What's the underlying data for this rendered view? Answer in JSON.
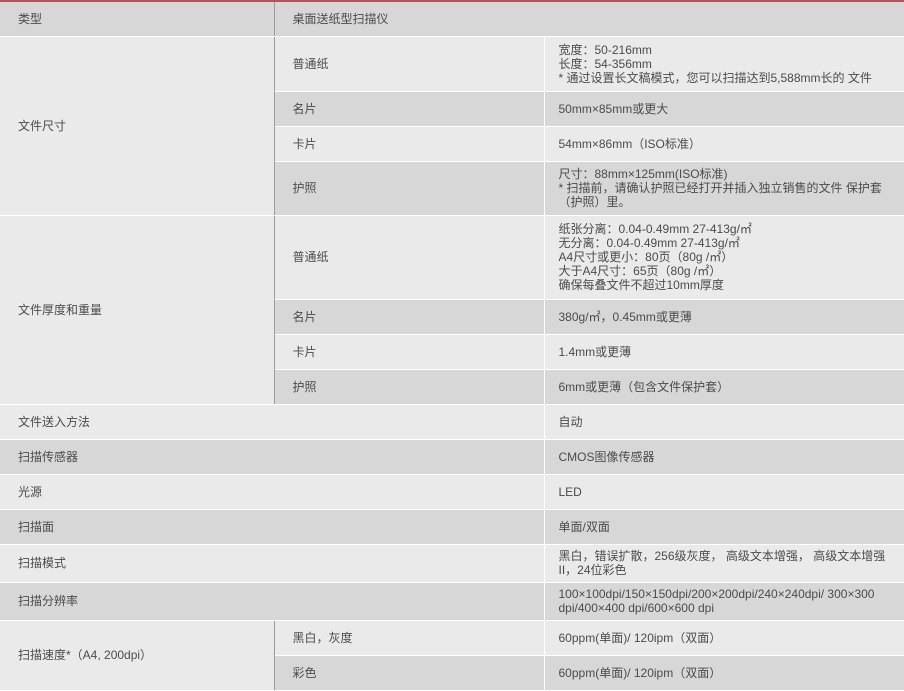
{
  "header": {
    "label": "类型",
    "value": "桌面送纸型扫描仪"
  },
  "doc_size": {
    "label": "文件尺寸",
    "rows": [
      {
        "sub": "普通纸",
        "lines": [
          "宽度：50-216mm",
          "长度：54-356mm",
          "* 通过设置长文稿模式，您可以扫描达到5,588mm长的 文件"
        ]
      },
      {
        "sub": "名片",
        "lines": [
          "50mm×85mm或更大"
        ]
      },
      {
        "sub": "卡片",
        "lines": [
          "54mm×86mm（ISO标准）"
        ]
      },
      {
        "sub": "护照",
        "lines": [
          "尺寸：88mm×125mm(ISO标准)",
          "* 扫描前，请确认护照已经打开并插入独立销售的文件 保护套",
          "（护照）里。"
        ]
      }
    ]
  },
  "doc_thickness": {
    "label": "文件厚度和重量",
    "rows": [
      {
        "sub": "普通纸",
        "lines": [
          "纸张分离：0.04-0.49mm 27-413g/㎡",
          "无分离：0.04-0.49mm 27-413g/㎡",
          "A4尺寸或更小：80页（80g /㎡）",
          "大于A4尺寸：65页（80g /㎡）",
          "确保每叠文件不超过10mm厚度"
        ]
      },
      {
        "sub": "名片",
        "lines": [
          "380g/㎡，0.45mm或更薄"
        ]
      },
      {
        "sub": "卡片",
        "lines": [
          "1.4mm或更薄"
        ]
      },
      {
        "sub": "护照",
        "lines": [
          "6mm或更薄（包含文件保护套）"
        ]
      }
    ]
  },
  "simple_rows": [
    {
      "label": "文件送入方法",
      "lines": [
        "自动"
      ]
    },
    {
      "label": "扫描传感器",
      "lines": [
        "CMOS图像传感器"
      ]
    },
    {
      "label": "光源",
      "lines": [
        "LED"
      ]
    },
    {
      "label": "扫描面",
      "lines": [
        "单面/双面"
      ]
    },
    {
      "label": "扫描模式",
      "lines": [
        "黑白，错误扩散，256级灰度， 高级文本增强， 高级文本增强",
        "II，24位彩色"
      ]
    },
    {
      "label": "扫描分辨率",
      "lines": [
        "100×100dpi/150×150dpi/200×200dpi/240×240dpi/ 300×300",
        "dpi/400×400 dpi/600×600 dpi"
      ]
    }
  ],
  "scan_speed": {
    "label": "扫描速度*（A4, 200dpi）",
    "rows": [
      {
        "sub": "黑白，灰度",
        "lines": [
          "60ppm(单面)/ 120ipm（双面）"
        ]
      },
      {
        "sub": "彩色",
        "lines": [
          "60ppm(单面)/ 120ipm（双面）"
        ]
      }
    ]
  },
  "colors": {
    "accent": "#b5535b",
    "row_dark": "#d7d7d7",
    "row_light": "#eaeaea",
    "text": "#4b4b4b"
  }
}
